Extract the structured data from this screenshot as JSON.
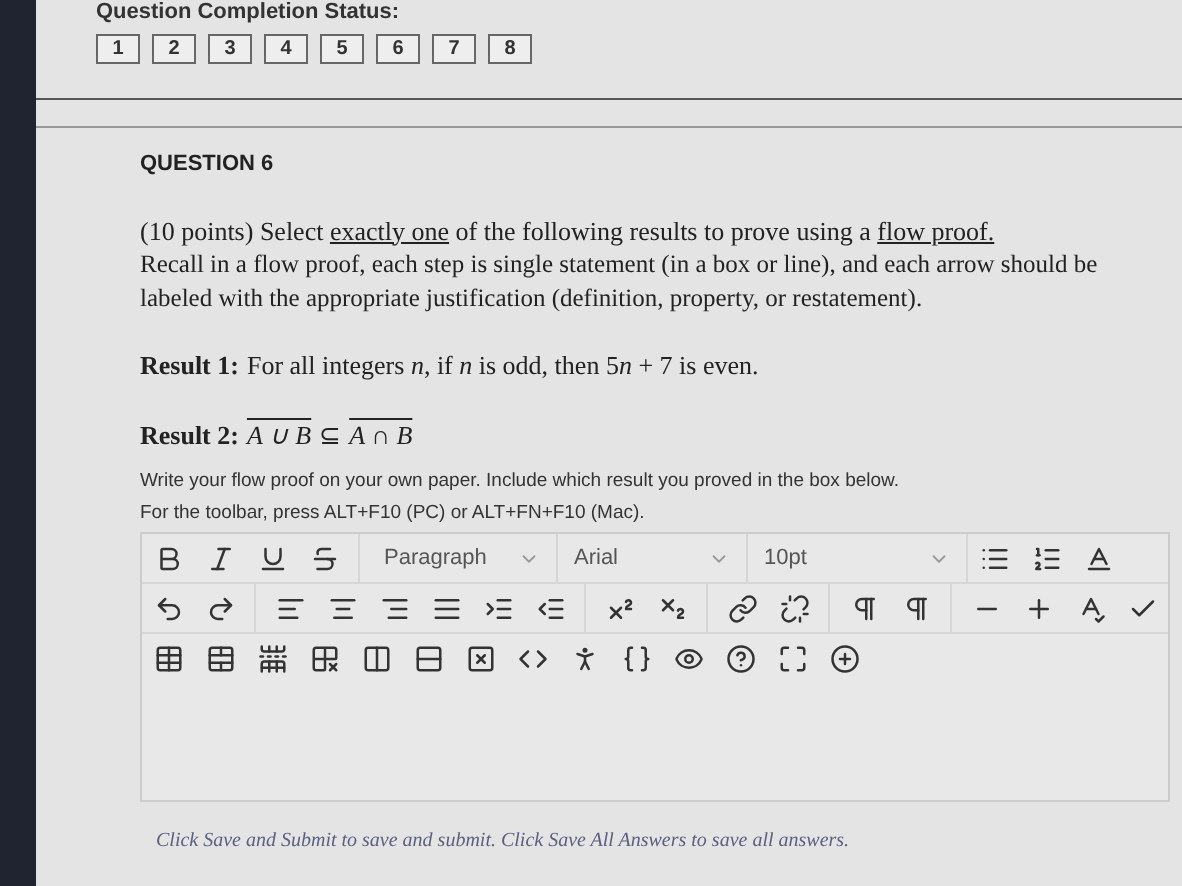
{
  "completion_status": {
    "label": "Question Completion Status:",
    "questions": [
      {
        "number": "1"
      },
      {
        "number": "2"
      },
      {
        "number": "3"
      },
      {
        "number": "4"
      },
      {
        "number": "5"
      },
      {
        "number": "6"
      },
      {
        "number": "7"
      },
      {
        "number": "8"
      }
    ]
  },
  "question": {
    "title": "QUESTION 6",
    "prompt": [
      {
        "kind": "plain",
        "text": "(10 points) Select "
      },
      {
        "kind": "underlined",
        "text": "exactly one"
      },
      {
        "kind": "plain",
        "text": " of the following results to prove using a "
      },
      {
        "kind": "underlined",
        "text": "flow proof."
      }
    ],
    "recall": "Recall in a flow proof, each step is single statement (in a box or line), and each arrow should be labeled with the appropriate justification (definition, property, or restatement).",
    "result_1": {
      "label": "Result 1:",
      "statement": [
        {
          "kind": "text",
          "text": "For all integers "
        },
        {
          "kind": "variable",
          "text": "n"
        },
        {
          "kind": "text",
          "text": ", if "
        },
        {
          "kind": "variable",
          "text": "n"
        },
        {
          "kind": "text",
          "text": " is odd, then 5"
        },
        {
          "kind": "variable",
          "text": "n"
        },
        {
          "kind": "text",
          "text": " + 7 is even."
        }
      ]
    },
    "result_2": {
      "label": "Result 2:",
      "left": "A ∪ B",
      "relation": "⊆",
      "right": "A ∩ B"
    },
    "instructions": "Write your flow proof on your own paper. Include which result you proved in the box below.",
    "toolbar_hint": "For the toolbar, press ALT+F10 (PC) or ALT+FN+F10 (Mac).",
    "editor": {
      "block_format": "Paragraph",
      "font": "Arial",
      "font_size": "10pt"
    }
  },
  "footer": "Click Save and Submit to save and submit. Click Save All Answers to save all answers."
}
